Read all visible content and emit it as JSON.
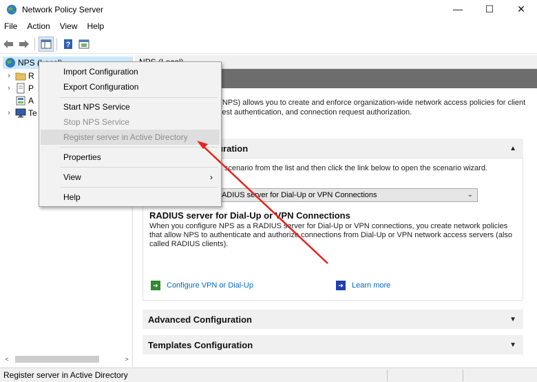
{
  "window": {
    "title": "Network Policy Server",
    "minimize": "—",
    "maximize": "☐",
    "close": "✕"
  },
  "menubar": [
    "File",
    "Action",
    "View",
    "Help"
  ],
  "tree": {
    "root": "NPS (Local)",
    "children": [
      "R",
      "P",
      "A",
      "Te"
    ]
  },
  "right_pane": {
    "header": "NPS (Local)",
    "intro": "Network Policy Server (NPS) allows you to create and enforce organization-wide network access policies for client health, connection request authentication, and connection request authorization.",
    "standard": {
      "title": "Standard Configuration",
      "instruction": "Select a configuration scenario from the list and then click the link below to open the scenario wizard.",
      "select_value": "RADIUS server for Dial-Up or VPN Connections",
      "radius_title": "RADIUS server for Dial-Up or VPN Connections",
      "radius_desc": "When you configure NPS as a RADIUS server for Dial-Up or VPN connections, you create network policies that allow NPS to authenticate and authorize connections from Dial-Up or VPN network access servers (also called RADIUS clients).",
      "configure_link": "Configure VPN or Dial-Up",
      "learn_link": "Learn more"
    },
    "advanced": "Advanced Configuration",
    "templates": "Templates Configuration"
  },
  "context_menu": {
    "import": "Import Configuration",
    "export": "Export Configuration",
    "start": "Start NPS Service",
    "stop": "Stop NPS Service",
    "register": "Register server in Active Directory",
    "properties": "Properties",
    "view": "View",
    "help": "Help"
  },
  "statusbar": {
    "text": "Register server in Active Directory"
  },
  "colors": {
    "accent_arrow": "#e8211b",
    "link": "#0066cc",
    "selection": "#cce8ff",
    "band": "#6d6d6d"
  }
}
